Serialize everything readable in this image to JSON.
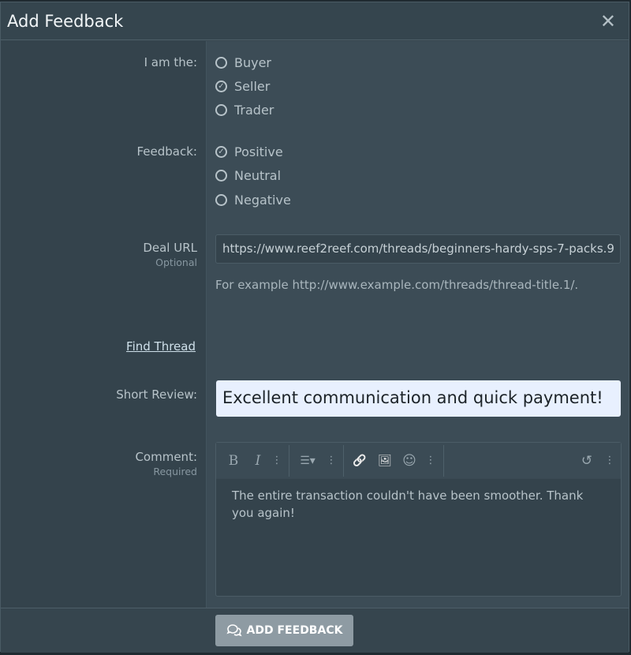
{
  "modal": {
    "title": "Add Feedback",
    "close": "✕"
  },
  "role": {
    "label": "I am the:",
    "options": [
      {
        "label": "Buyer",
        "checked": false
      },
      {
        "label": "Seller",
        "checked": true
      },
      {
        "label": "Trader",
        "checked": false
      }
    ]
  },
  "feedback": {
    "label": "Feedback:",
    "options": [
      {
        "label": "Positive",
        "checked": true
      },
      {
        "label": "Neutral",
        "checked": false
      },
      {
        "label": "Negative",
        "checked": false
      }
    ]
  },
  "deal_url": {
    "label": "Deal URL",
    "hint": "Optional",
    "value": "https://www.reef2reef.com/threads/beginners-hardy-sps-7-packs.9",
    "example": "For example http://www.example.com/threads/thread-title.1/."
  },
  "find_thread": "Find Thread",
  "short_review": {
    "label": "Short Review:",
    "value": "Excellent communication and quick payment!"
  },
  "comment": {
    "label": "Comment:",
    "hint": "Required",
    "value": "The entire transaction couldn't have been smoother. Thank you again!",
    "toolbar": {
      "bold": "B",
      "italic": "I",
      "more": "⋮",
      "list": "☰▾",
      "link": "🔗",
      "image": "🖼",
      "emoji": "☺",
      "undo": "↺"
    }
  },
  "submit": {
    "label": "ADD FEEDBACK",
    "icon": "comments-icon"
  }
}
